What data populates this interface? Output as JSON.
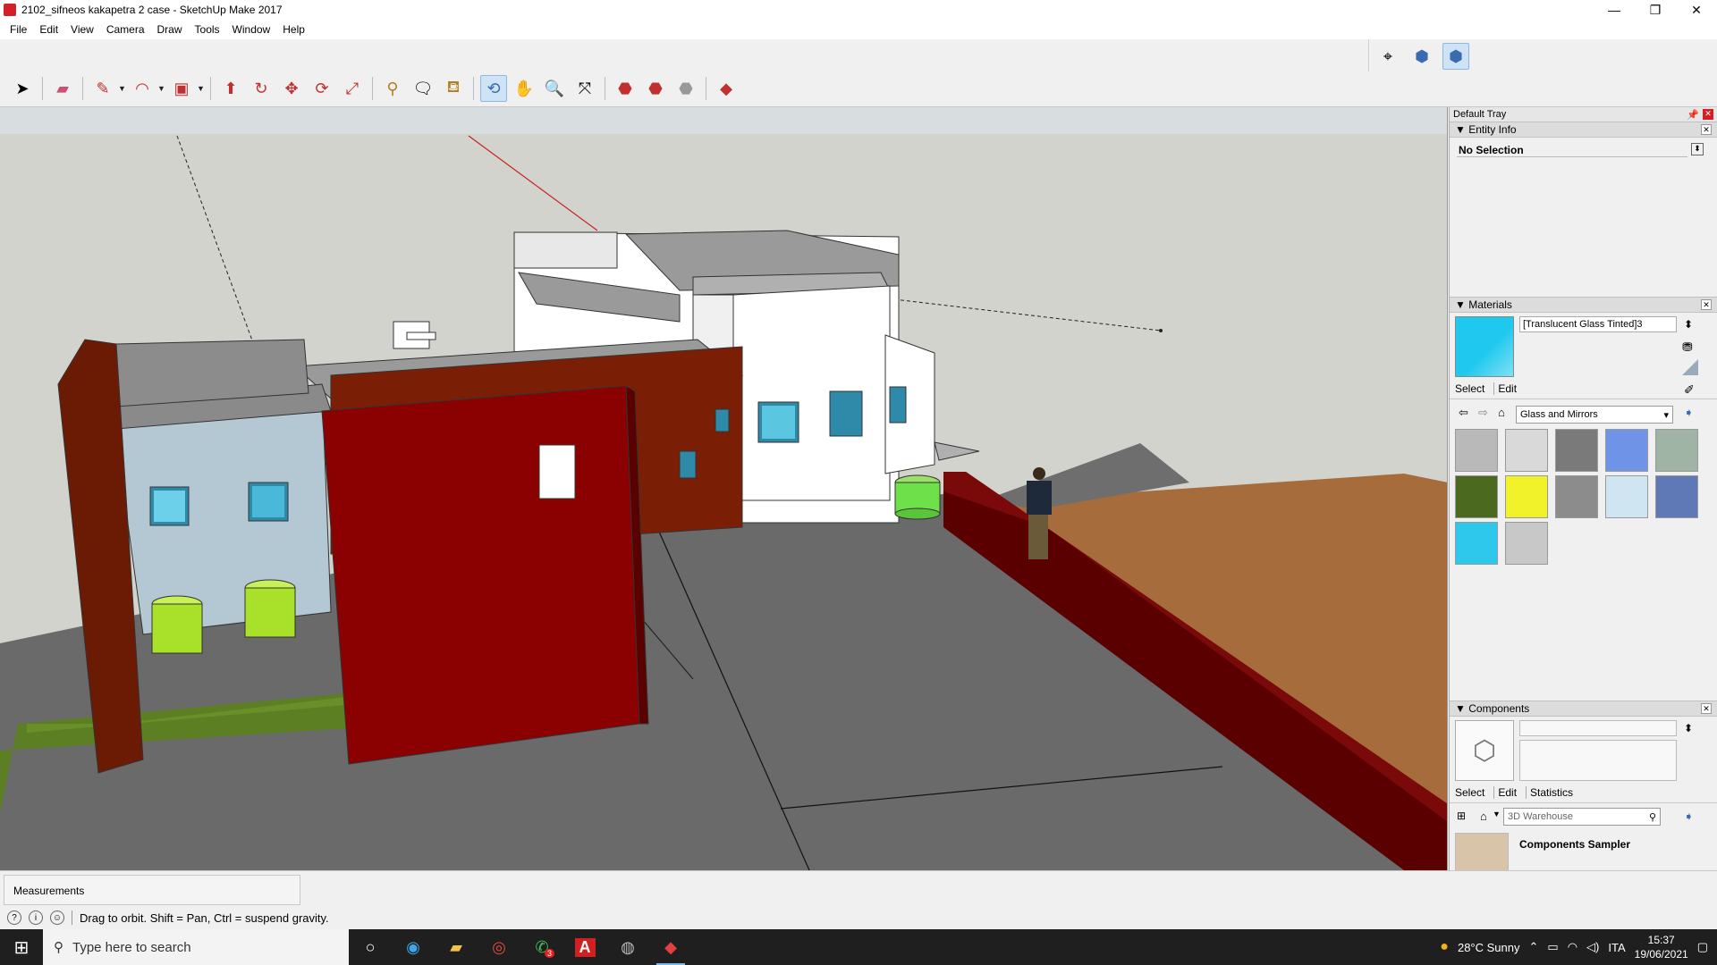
{
  "window": {
    "title": "2102_sifneos kakapetra 2 case - SketchUp Make 2017",
    "minimize": "—",
    "maximize": "❐",
    "close": "✕"
  },
  "menu": [
    "File",
    "Edit",
    "View",
    "Camera",
    "Draw",
    "Tools",
    "Window",
    "Help"
  ],
  "tray": {
    "title": "Default Tray",
    "entity_info": {
      "header": "Entity Info",
      "selection": "No Selection"
    },
    "materials": {
      "header": "Materials",
      "current": "[Translucent Glass Tinted]3",
      "tab_select": "Select",
      "tab_edit": "Edit",
      "library": "Glass and Mirrors",
      "swatches": [
        "#b9b9b9",
        "#d9d9d9",
        "#7a7a7a",
        "#6f93e6",
        "#9fb4a4",
        "#4c6a1f",
        "#f2f22a",
        "#8c8c8c",
        "#cfe6f2",
        "#5f78b6",
        "#2ec8ec",
        "#c8c8c8"
      ]
    },
    "components": {
      "header": "Components",
      "tab_select": "Select",
      "tab_edit": "Edit",
      "tab_statistics": "Statistics",
      "search_placeholder": "3D Warehouse",
      "sampler": "Components Sampler"
    }
  },
  "status": {
    "measurements_label": "Measurements",
    "hint": "Drag to orbit. Shift = Pan, Ctrl = suspend gravity."
  },
  "taskbar": {
    "search_placeholder": "Type here to search",
    "weather": "28°C  Sunny",
    "lang": "ITA",
    "time": "15:37",
    "date": "19/06/2021",
    "whatsapp_badge": "3"
  }
}
